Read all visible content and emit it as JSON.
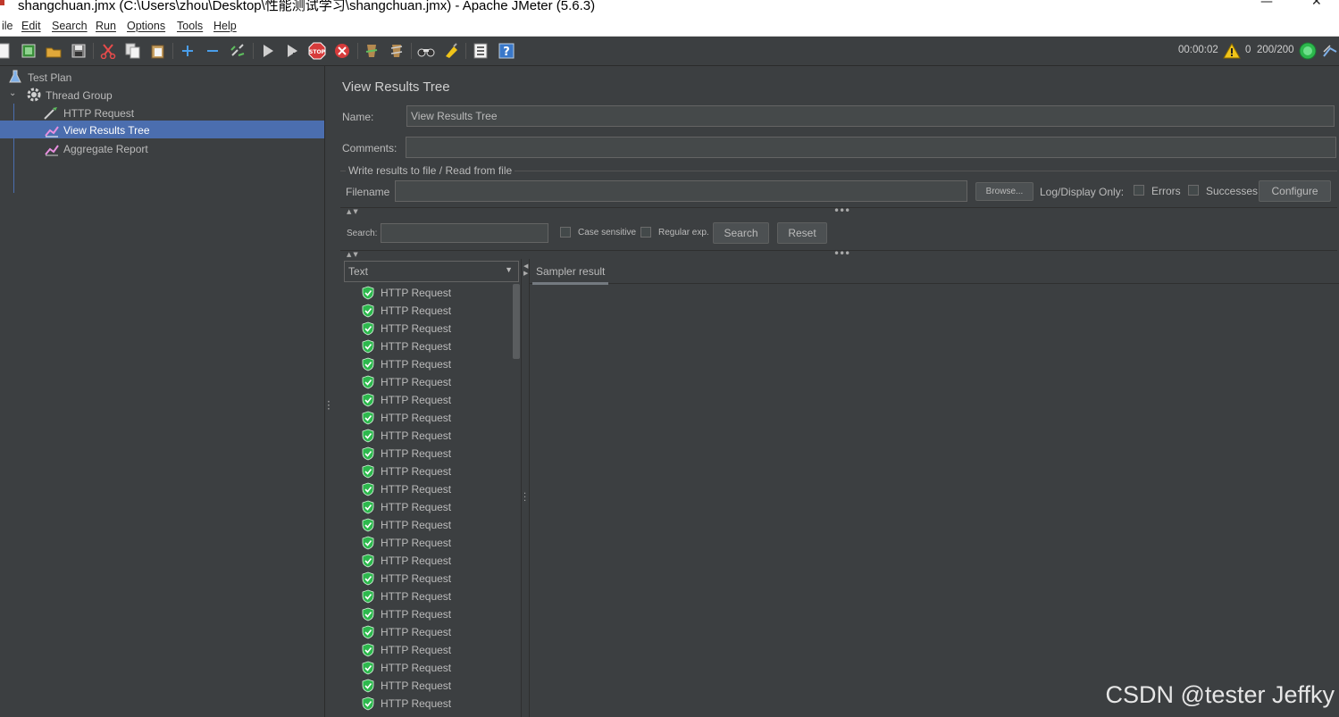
{
  "window": {
    "title": "shangchuan.jmx (C:\\Users\\zhou\\Desktop\\性能测试学习\\shangchuan.jmx) - Apache JMeter (5.6.3)",
    "minimize_glyph": "—",
    "close_glyph": "✕"
  },
  "menu": [
    "ile",
    "Edit",
    "Search",
    "Run",
    "Options",
    "Tools",
    "Help"
  ],
  "toolbar": {
    "icons": [
      "new-icon",
      "templates-icon",
      "open-icon",
      "save-icon",
      "cut-icon",
      "copy-icon",
      "paste-icon",
      "expand-icon",
      "collapse-icon",
      "toggle-icon",
      "start-icon",
      "start-no-pause-icon",
      "stop-icon",
      "shutdown-icon",
      "clear-icon",
      "clear-all-icon",
      "search-icon",
      "reset-search-icon",
      "function-helper-icon",
      "help-icon"
    ],
    "elapsed": "00:00:02",
    "warnings": "0",
    "threads": "200/200"
  },
  "tree": {
    "items": [
      {
        "label": "Test Plan",
        "icon": "test-plan-icon"
      },
      {
        "label": "Thread Group",
        "icon": "gear-icon"
      },
      {
        "label": "HTTP Request",
        "icon": "pipette-icon"
      },
      {
        "label": "View Results Tree",
        "icon": "chart-icon",
        "selected": true
      },
      {
        "label": "Aggregate Report",
        "icon": "chart-icon"
      }
    ]
  },
  "panel": {
    "heading": "View Results Tree",
    "name_label": "Name:",
    "name_value": "View Results Tree",
    "comments_label": "Comments:",
    "comments_value": "",
    "file_group_title": "Write results to file / Read from file",
    "filename_label": "Filename",
    "filename_value": "",
    "browse_label": "Browse...",
    "log_display_label": "Log/Display Only:",
    "errors_label": "Errors",
    "successes_label": "Successes",
    "configure_label": "Configure",
    "search_label": "Search:",
    "search_value": "",
    "case_sensitive_label": "Case sensitive",
    "regex_label": "Regular exp.",
    "search_button": "Search",
    "reset_button": "Reset",
    "renderer_value": "Text",
    "result_tab": "Sampler result"
  },
  "results": [
    "HTTP Request",
    "HTTP Request",
    "HTTP Request",
    "HTTP Request",
    "HTTP Request",
    "HTTP Request",
    "HTTP Request",
    "HTTP Request",
    "HTTP Request",
    "HTTP Request",
    "HTTP Request",
    "HTTP Request",
    "HTTP Request",
    "HTTP Request",
    "HTTP Request",
    "HTTP Request",
    "HTTP Request",
    "HTTP Request",
    "HTTP Request",
    "HTTP Request",
    "HTTP Request",
    "HTTP Request",
    "HTTP Request",
    "HTTP Request"
  ],
  "watermark": "CSDN @tester Jeffky",
  "colors": {
    "background": "#3c3f41",
    "selection": "#4b6eaf",
    "success": "#2db84d"
  }
}
